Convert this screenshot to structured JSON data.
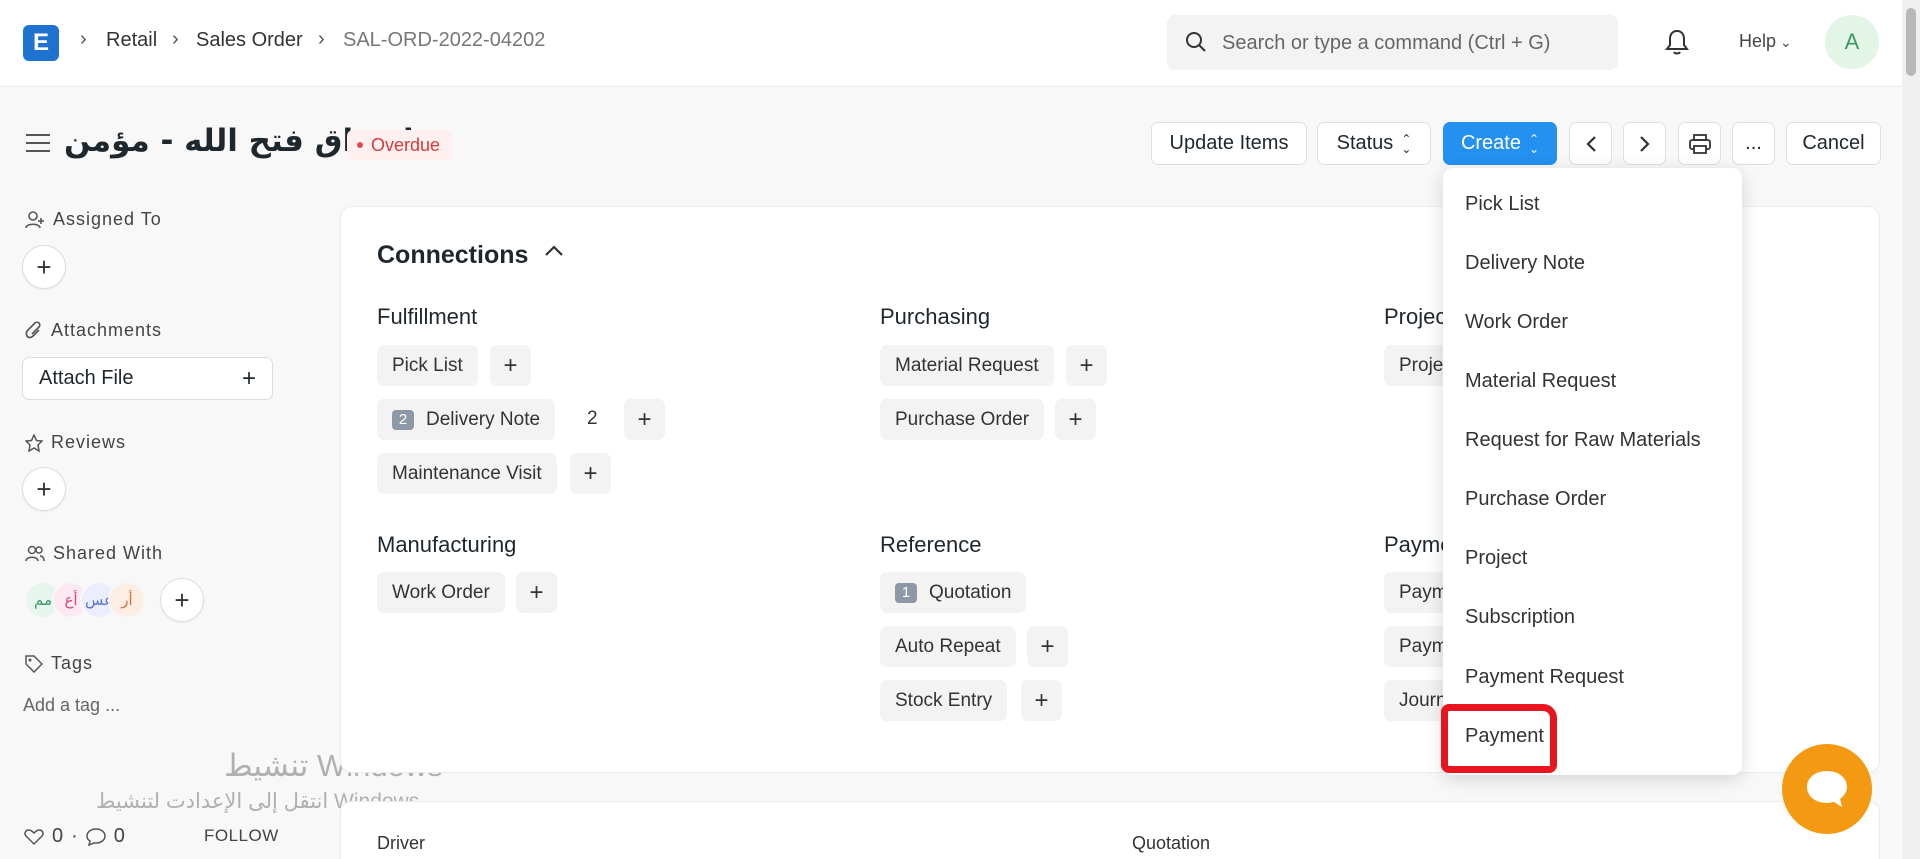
{
  "navbar": {
    "logo_letter": "E",
    "breadcrumbs": [
      "Retail",
      "Sales Order",
      "SAL-ORD-2022-04202"
    ],
    "search_placeholder": "Search or type a command (Ctrl + G)",
    "help_label": "Help",
    "avatar_letter": "A"
  },
  "page": {
    "title": "اسواق فتح الله - مؤمن",
    "status_badge": "Overdue"
  },
  "actions": {
    "update_items": "Update Items",
    "status": "Status",
    "create": "Create",
    "more": "...",
    "cancel": "Cancel"
  },
  "sidebar": {
    "assigned_to": "Assigned To",
    "attachments": "Attachments",
    "attach_file": "Attach File",
    "reviews": "Reviews",
    "shared_with": "Shared With",
    "shared_avatars": [
      "مم",
      "أع",
      "عس",
      "أر"
    ],
    "tags": "Tags",
    "add_tag": "Add a tag ...",
    "likes": "0",
    "comments": "0",
    "follow": "FOLLOW"
  },
  "overlay": {
    "windows_line1": "تنشيط Windows",
    "windows_line2": "انتقل إلى الإعدادت لتنشيط Windows."
  },
  "connections": {
    "title": "Connections",
    "groups": {
      "fulfillment": "Fulfillment",
      "purchasing": "Purchasing",
      "projects": "Projec",
      "manufacturing": "Manufacturing",
      "reference": "Reference",
      "payments": "Payme"
    },
    "items": {
      "pick_list": "Pick List",
      "delivery_note": "Delivery Note",
      "delivery_note_count": "2",
      "delivery_note_total": "2",
      "maintenance_visit": "Maintenance Visit",
      "material_request": "Material Request",
      "purchase_order": "Purchase Order",
      "project": "Proje",
      "work_order": "Work Order",
      "quotation": "Quotation",
      "quotation_count": "1",
      "auto_repeat": "Auto Repeat",
      "stock_entry": "Stock Entry",
      "payment_1": "Paym",
      "payment_2": "Paym",
      "journal": "Journ"
    }
  },
  "details": {
    "driver_label": "Driver",
    "quotation_label": "Quotation"
  },
  "create_menu": {
    "items": [
      "Pick List",
      "Delivery Note",
      "Work Order",
      "Material Request",
      "Request for Raw Materials",
      "Purchase Order",
      "Project",
      "Subscription",
      "Payment Request",
      "Payment"
    ]
  },
  "colors": {
    "primary": "#2490ef",
    "overdue": "#d63b3b",
    "highlight": "#e8151e",
    "chat": "#f39a12"
  }
}
